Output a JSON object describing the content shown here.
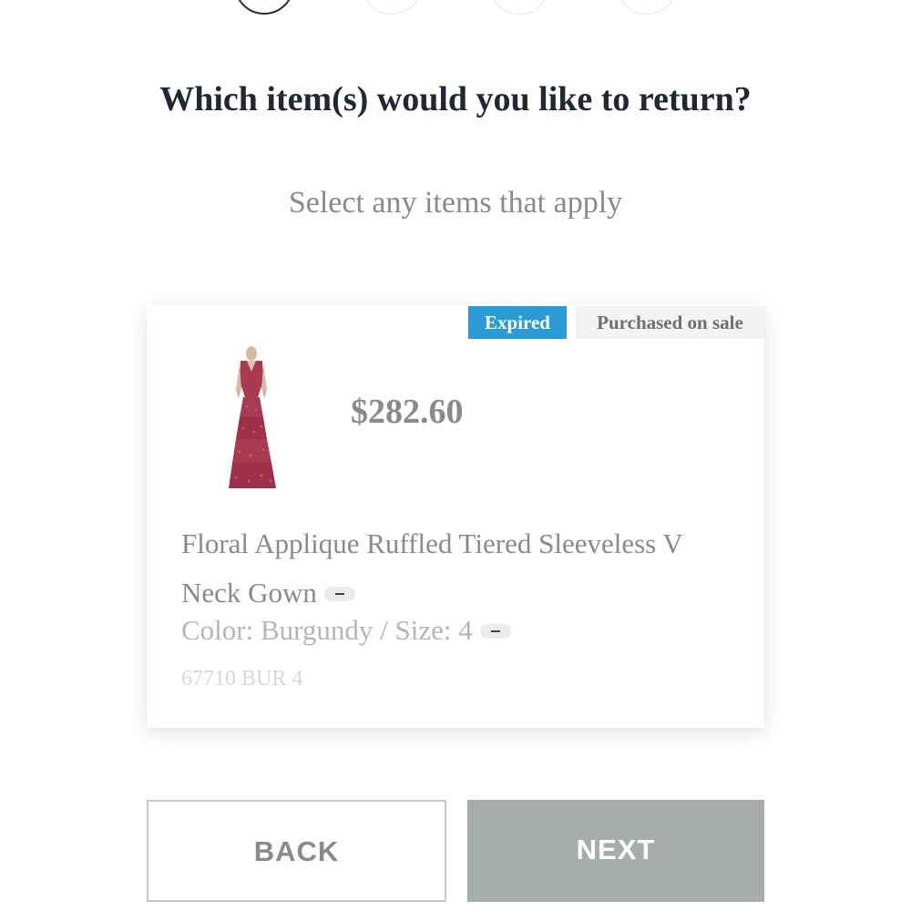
{
  "header": {
    "title": "Which item(s) would you like to return?",
    "subtitle": "Select any items that apply"
  },
  "steps": [
    {
      "state": "active"
    },
    {
      "state": "inactive"
    },
    {
      "state": "inactive"
    },
    {
      "state": "inactive"
    }
  ],
  "item": {
    "badges": {
      "expired": "Expired",
      "sale": "Purchased on sale"
    },
    "image_icon": "burgundy-tiered-gown",
    "price": "$282.60",
    "name": "Floral Applique Ruffled Tiered Sleeveless V Neck Gown",
    "variant": "Color: Burgundy / Size: 4",
    "sku": "67710 BUR 4"
  },
  "actions": {
    "back_label": "BACK",
    "next_label": "NEXT"
  },
  "colors": {
    "expired_badge": "#2a9bd3",
    "next_button": "#a9acad",
    "dress": "#a83a52"
  }
}
